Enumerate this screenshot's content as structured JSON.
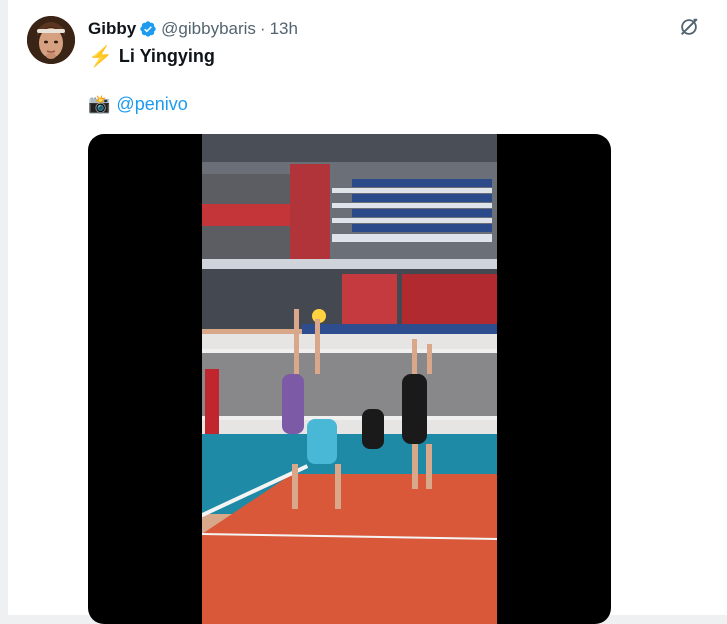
{
  "tweet": {
    "author_name": "Gibby",
    "author_handle": "@gibbybaris",
    "separator": "·",
    "timestamp": "13h",
    "line1_emoji": "⚡",
    "line1_text": "Li Yingying",
    "line2_emoji": "📸",
    "line2_mention": "@penivo"
  },
  "colors": {
    "accent": "#1d9bf0",
    "verified": "#1d9bf0",
    "text_primary": "#0f1419",
    "text_secondary": "#536471"
  },
  "icons": {
    "verified": "verified-badge-icon",
    "grok": "grok-icon"
  }
}
